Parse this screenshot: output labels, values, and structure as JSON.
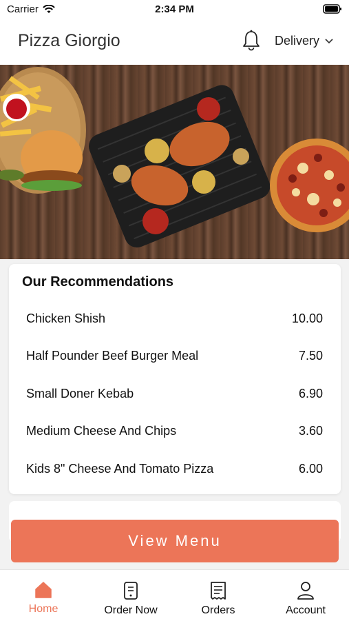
{
  "status": {
    "carrier": "Carrier",
    "time": "2:34 PM"
  },
  "header": {
    "title": "Pizza Giorgio",
    "delivery_label": "Delivery"
  },
  "recommendations": {
    "heading": "Our Recommendations",
    "items": [
      {
        "name": "Chicken Shish",
        "price": "10.00"
      },
      {
        "name": "Half Pounder Beef Burger Meal",
        "price": "7.50"
      },
      {
        "name": "Small Doner Kebab",
        "price": "6.90"
      },
      {
        "name": "Medium Cheese And Chips",
        "price": "3.60"
      },
      {
        "name": "Kids 8\" Cheese And Tomato Pizza",
        "price": "6.00"
      }
    ]
  },
  "cta": {
    "label": "View Menu"
  },
  "tabs": [
    {
      "label": "Home",
      "icon": "home-icon",
      "active": true
    },
    {
      "label": "Order Now",
      "icon": "order-icon",
      "active": false
    },
    {
      "label": "Orders",
      "icon": "receipt-icon",
      "active": false
    },
    {
      "label": "Account",
      "icon": "user-icon",
      "active": false
    }
  ],
  "colors": {
    "accent": "#ec7558",
    "background": "#f2f2f2"
  }
}
